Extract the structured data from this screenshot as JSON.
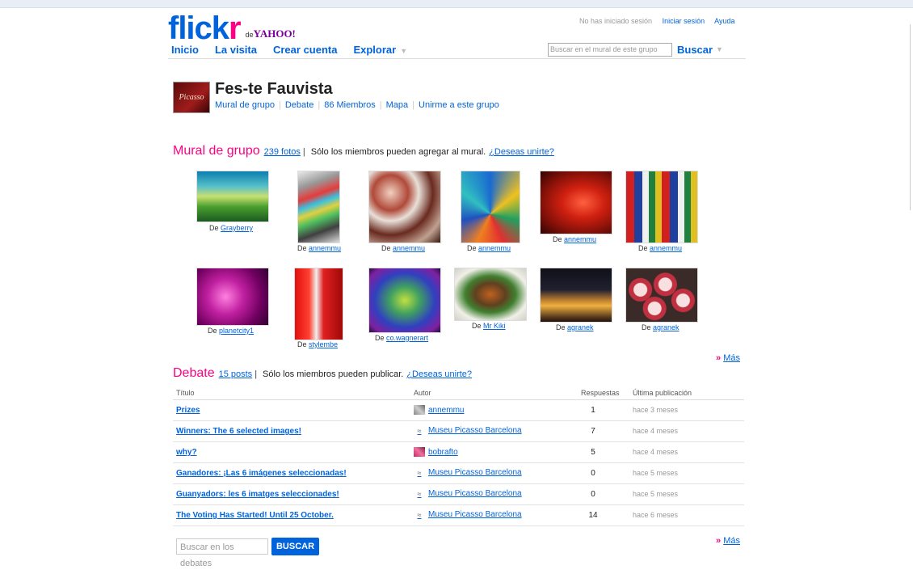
{
  "header": {
    "logo_word_blue": "flick",
    "logo_word_pink": "r",
    "logo_de": "de",
    "logo_yahoo": "YAHOO!",
    "nav": [
      "Inicio",
      "La visita",
      "Crear cuenta",
      "Explorar"
    ],
    "status": "No has iniciado sesión",
    "login": "Iniciar sesión",
    "help": "Ayuda",
    "search_placeholder": "Buscar en el mural de este grupo",
    "search_button": "Buscar"
  },
  "group": {
    "icon_text": "Picasso",
    "title": "Fes-te Fauvista",
    "links": [
      "Mural de grupo",
      "Debate",
      "86 Miembros",
      "Mapa",
      "Unirme a este grupo"
    ]
  },
  "pool": {
    "heading": "Mural de grupo",
    "count": "239 fotos",
    "note": "Sólo los miembros pueden agregar al mural.",
    "join": "¿Deseas unirte?",
    "by": "De",
    "photos": [
      {
        "author": "Grayberry"
      },
      {
        "author": "annemmu"
      },
      {
        "author": "annemmu"
      },
      {
        "author": "annemmu"
      },
      {
        "author": "annemmu"
      },
      {
        "author": "annemmu"
      },
      {
        "author": "planetcity1"
      },
      {
        "author": "stylembe"
      },
      {
        "author": "co.wagnerart"
      },
      {
        "author": "Mr Kiki"
      },
      {
        "author": "agranek"
      },
      {
        "author": "agranek"
      }
    ],
    "more_arrow": "»",
    "more": "Más"
  },
  "discuss": {
    "heading": "Debate",
    "count": "15 posts",
    "note": "Sólo los miembros pueden publicar.",
    "join": "¿Deseas unirte?",
    "columns": [
      "Título",
      "Autor",
      "Respuestas",
      "Última publicación"
    ],
    "rows": [
      {
        "title": "Prizes",
        "author": "annemmu",
        "replies": "1",
        "last": "hace 3 meses"
      },
      {
        "title": "Winners: The 6 selected images!",
        "author": "Museu Picasso Barcelona",
        "replies": "7",
        "last": "hace 4 meses"
      },
      {
        "title": "why?",
        "author": "bobrafto",
        "replies": "5",
        "last": "hace 4 meses"
      },
      {
        "title": "Ganadores: ¡Las 6 imágenes seleccionadas!",
        "author": "Museu Picasso Barcelona",
        "replies": "0",
        "last": "hace 5 meses"
      },
      {
        "title": "Guanyadors: les 6 imatges seleccionades!",
        "author": "Museu Picasso Barcelona",
        "replies": "0",
        "last": "hace 5 meses"
      },
      {
        "title": "The Voting Has Started! Until 25 October.",
        "author": "Museu Picasso Barcelona",
        "replies": "14",
        "last": "hace 6 meses"
      }
    ],
    "search_placeholder": "Buscar en los debates",
    "search_button": "BUSCAR",
    "more_arrow": "»",
    "more": "Más"
  }
}
